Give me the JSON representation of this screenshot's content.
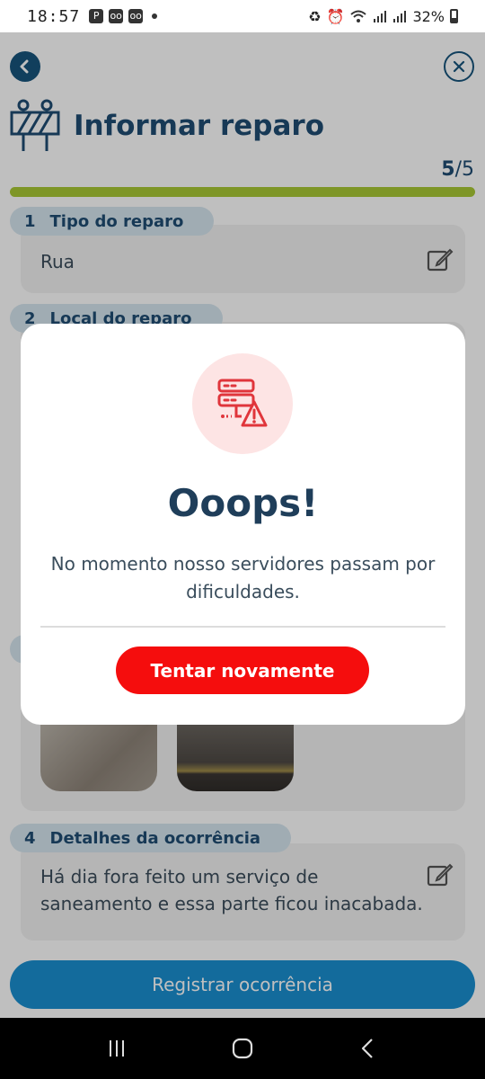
{
  "status_bar": {
    "time": "18:57",
    "notification_icons": [
      "parking-icon",
      "voicemail-icon",
      "voicemail-icon"
    ],
    "battery": "32%",
    "system_icons": [
      "recycle-icon",
      "alarm-icon",
      "wifi-icon",
      "signal-icon",
      "signal-icon",
      "battery-icon"
    ]
  },
  "header": {
    "title": "Informar reparo",
    "progress_current": "5",
    "progress_total": "/5",
    "progress_fraction": 1.0
  },
  "steps": [
    {
      "number": "1",
      "label": "Tipo do reparo",
      "value": "Rua"
    },
    {
      "number": "2",
      "label": "Local do reparo"
    },
    {
      "number": "4",
      "label": "Detalhes da ocorrência",
      "value": "Há dia fora feito um serviço de saneamento e essa parte ficou inacabada."
    }
  ],
  "photos": [
    "photo-1",
    "photo-2"
  ],
  "primary_button": "Registrar ocorrência",
  "modal": {
    "title": "Ooops!",
    "message": "No momento nosso servidores passam por dificuldades.",
    "button": "Tentar novamente"
  },
  "colors": {
    "brand_dark": "#1f4d73",
    "progress": "#a8c835",
    "primary": "#1a8fd1",
    "danger": "#f50d0d",
    "error_icon_bg": "#fde4e4"
  }
}
